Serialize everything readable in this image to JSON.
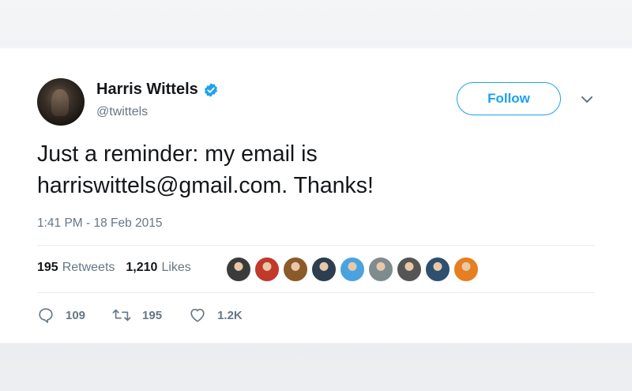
{
  "author": {
    "name": "Harris Wittels",
    "handle": "@twittels",
    "verified_icon": "verified-badge-icon",
    "avatar_icon": "profile-photo"
  },
  "follow_button": {
    "label": "Follow"
  },
  "menu": {
    "icon": "chevron-down-icon"
  },
  "tweet": {
    "lines": [
      "Just a reminder: my email is",
      "harriswittels@gmail.com. Thanks!"
    ],
    "timestamp": "1:41 PM - 18 Feb 2015"
  },
  "stats": {
    "retweets_count": "195",
    "retweets_label": "Retweets",
    "likes_count": "1,210",
    "likes_label": "Likes"
  },
  "likers": {
    "colors": [
      "#3b3b3b",
      "#c0392b",
      "#8b5a2b",
      "#2c3e50",
      "#4aa3df",
      "#7f8c8d",
      "#555555",
      "#2f4f6f",
      "#e67e22"
    ]
  },
  "actions": {
    "reply_count": "109",
    "retweet_count": "195",
    "like_count": "1.2K"
  },
  "colors": {
    "accent": "#1da1f2",
    "text": "#14171a",
    "muted": "#657786",
    "divider": "#e6ecf0"
  }
}
